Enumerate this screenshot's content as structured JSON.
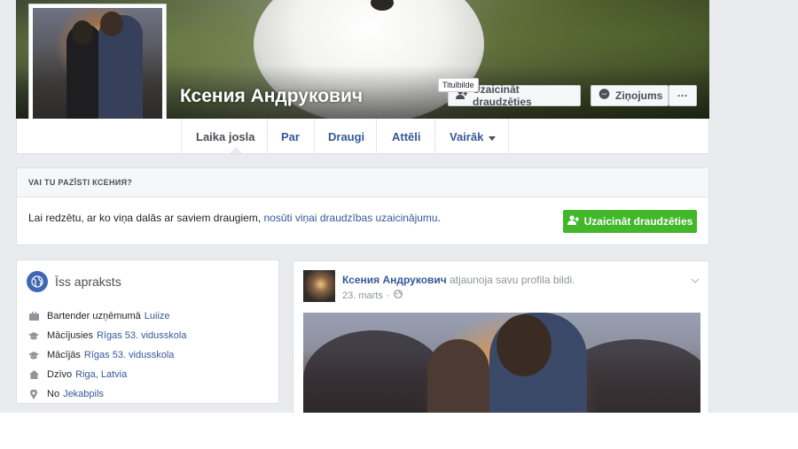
{
  "profile": {
    "name": "Ксения Андрукович"
  },
  "cover_actions": {
    "tooltip": "Titulbilde",
    "add_friend_label": "Uzaicināt draudzēties",
    "message_label": "Ziņojums",
    "more_label": "···"
  },
  "tabs": [
    {
      "label": "Laika josla",
      "active": true
    },
    {
      "label": "Par"
    },
    {
      "label": "Draugi"
    },
    {
      "label": "Attēli"
    },
    {
      "label": "Vairāk"
    }
  ],
  "know_card": {
    "header": "VAI TU PAZĪSTI КСЕНИЯ?",
    "text": "Lai redzētu, ar ko viņa dalās ar saviem draugiem,",
    "link": "nosūti viņai draudzības uzaicinājumu",
    "suffix": ".",
    "button_label": "Uzaicināt draudzēties"
  },
  "intro": {
    "title": "Īss apraksts",
    "items": [
      {
        "icon": "briefcase-icon",
        "text": "Bartender uzņēmumā",
        "link": "Luiize"
      },
      {
        "icon": "graduation-cap-icon",
        "text": "Mācījusies",
        "link": "Rīgas 53. vidusskola"
      },
      {
        "icon": "graduation-cap-icon",
        "text": "Mācījās",
        "link": "Rīgas 53. vidusskola"
      },
      {
        "icon": "home-icon",
        "text": "Dzīvo",
        "link": "Riga, Latvia"
      },
      {
        "icon": "location-pin-icon",
        "text": "No",
        "link": "Jekabpils"
      }
    ]
  },
  "post": {
    "author": "Ксения Андрукович",
    "action": "atjaunoja savu profila bildi.",
    "date": "23. marts",
    "separator": "·"
  },
  "colors": {
    "link": "#365899",
    "green": "#42b72a",
    "background": "#e9ebee"
  }
}
